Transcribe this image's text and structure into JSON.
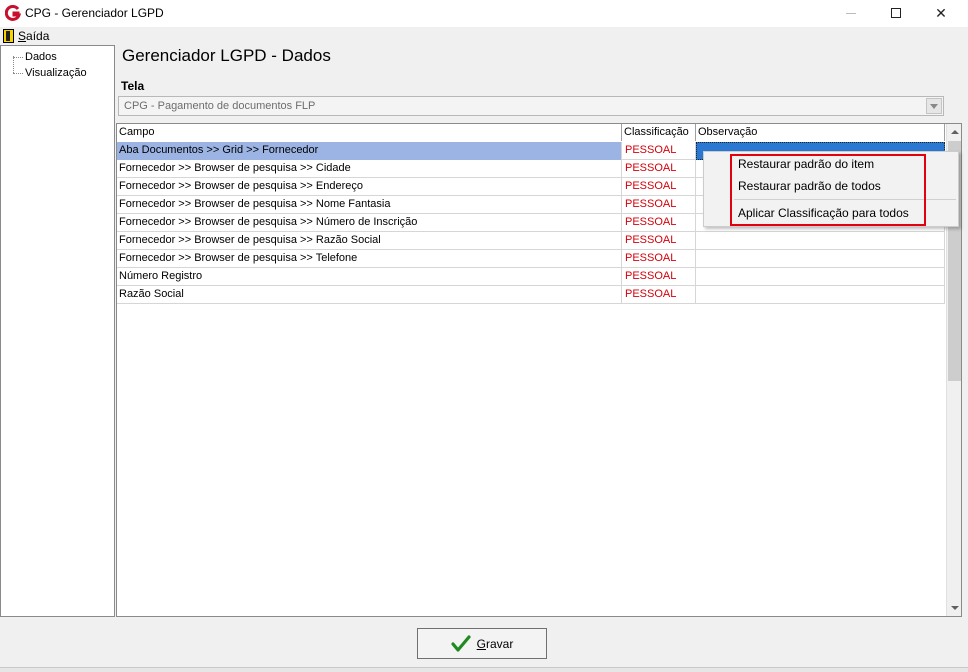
{
  "window": {
    "title": "CPG - Gerenciador LGPD",
    "minimize": "—",
    "maximize": "",
    "close": "✕"
  },
  "menu": {
    "exit_label_first": "S",
    "exit_label_rest": "aída"
  },
  "tree": {
    "items": [
      {
        "label": "Dados"
      },
      {
        "label": "Visualização"
      }
    ]
  },
  "main": {
    "title": "Gerenciador LGPD - Dados",
    "tela_label": "Tela",
    "tela_value": "CPG - Pagamento de documentos FLP"
  },
  "grid": {
    "headers": {
      "campo": "Campo",
      "classificacao": "Classificação",
      "observacao": "Observação"
    },
    "rows": [
      {
        "campo": "Aba Documentos >> Grid >> Fornecedor",
        "classificacao": "PESSOAL",
        "observacao": ""
      },
      {
        "campo": "Fornecedor >> Browser de pesquisa >> Cidade",
        "classificacao": "PESSOAL",
        "observacao": ""
      },
      {
        "campo": "Fornecedor >> Browser de pesquisa >> Endereço",
        "classificacao": "PESSOAL",
        "observacao": ""
      },
      {
        "campo": "Fornecedor >> Browser de pesquisa >> Nome Fantasia",
        "classificacao": "PESSOAL",
        "observacao": ""
      },
      {
        "campo": "Fornecedor >> Browser de pesquisa >> Número de Inscrição",
        "classificacao": "PESSOAL",
        "observacao": ""
      },
      {
        "campo": "Fornecedor >> Browser de pesquisa >> Razão Social",
        "classificacao": "PESSOAL",
        "observacao": ""
      },
      {
        "campo": "Fornecedor >> Browser de pesquisa >> Telefone",
        "classificacao": "PESSOAL",
        "observacao": ""
      },
      {
        "campo": "Número Registro",
        "classificacao": "PESSOAL",
        "observacao": ""
      },
      {
        "campo": "Razão Social",
        "classificacao": "PESSOAL",
        "observacao": ""
      }
    ],
    "selected_row": 0
  },
  "context_menu": {
    "items": [
      {
        "label": "Restaurar padrão do item"
      },
      {
        "label": "Restaurar padrão de todos"
      },
      {
        "label": "Aplicar Classificação para todos"
      }
    ]
  },
  "footer": {
    "save_first": "G",
    "save_rest": "ravar"
  },
  "colors": {
    "classification_text": "#d4000a",
    "selected_row": "#9cb4e3",
    "selected_cell": "#2a78d2",
    "highlight_box": "#e3000f"
  }
}
